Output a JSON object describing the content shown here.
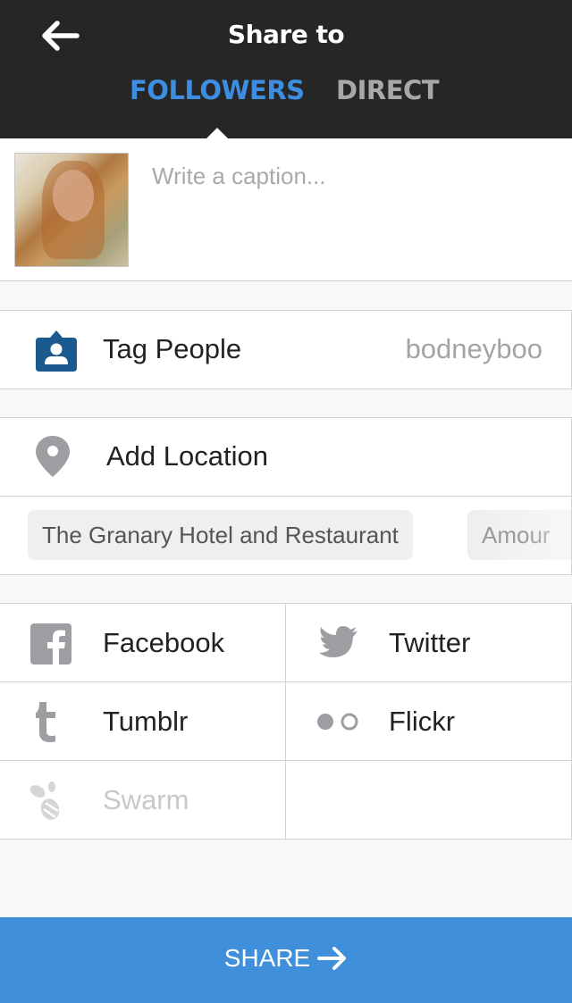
{
  "header": {
    "title": "Share to",
    "back_icon": "arrow-left-icon",
    "tabs": [
      {
        "label": "FOLLOWERS",
        "active": true
      },
      {
        "label": "DIRECT",
        "active": false
      }
    ]
  },
  "caption": {
    "placeholder": "Write a caption...",
    "value": "",
    "thumbnail": "photo-thumbnail"
  },
  "tag_people": {
    "icon": "person-tag-icon",
    "label": "Tag People",
    "value": "bodneyboo"
  },
  "location": {
    "icon": "location-pin-icon",
    "label": "Add Location",
    "suggestions": [
      "The Granary Hotel and Restaurant",
      "Amour"
    ]
  },
  "share_services": [
    {
      "name": "Facebook",
      "icon": "facebook-icon",
      "enabled": true
    },
    {
      "name": "Twitter",
      "icon": "twitter-icon",
      "enabled": true
    },
    {
      "name": "Tumblr",
      "icon": "tumblr-icon",
      "enabled": true
    },
    {
      "name": "Flickr",
      "icon": "flickr-icon",
      "enabled": true
    },
    {
      "name": "Swarm",
      "icon": "swarm-icon",
      "enabled": false
    }
  ],
  "share_button": {
    "label": "SHARE",
    "icon": "arrow-right-icon"
  },
  "colors": {
    "header_bg": "#262626",
    "accent": "#3d8ee0",
    "share_button_bg": "#3f8fdb",
    "tag_icon": "#1a5a8f",
    "icon_gray": "#9e9e9e"
  }
}
